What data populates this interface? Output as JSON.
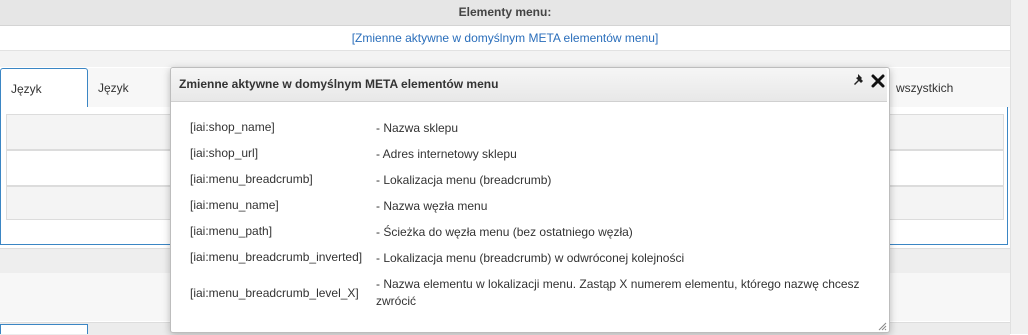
{
  "page": {
    "section_title": "Elementy menu:",
    "meta_link": "[Zmienne aktywne w domyślnym META elementów menu]"
  },
  "tabs": [
    {
      "label": "Język Polski",
      "active": true
    },
    {
      "label": "Język English",
      "active": false
    },
    {
      "label": "wszystkich językach",
      "active": false
    }
  ],
  "dialog": {
    "title": "Zmienne aktywne w domyślnym META elementów menu",
    "icons": {
      "pin": "pin-icon",
      "close": "close-icon"
    },
    "variables": [
      {
        "key": "[iai:shop_name]",
        "desc": "- Nazwa sklepu"
      },
      {
        "key": "[iai:shop_url]",
        "desc": "- Adres internetowy sklepu"
      },
      {
        "key": "[iai:menu_breadcrumb]",
        "desc": "- Lokalizacja menu (breadcrumb)"
      },
      {
        "key": "[iai:menu_name]",
        "desc": "- Nazwa węzła menu"
      },
      {
        "key": "[iai:menu_path]",
        "desc": "- Ścieżka do węzła menu (bez ostatniego węzła)"
      },
      {
        "key": "[iai:menu_breadcrumb_inverted]",
        "desc": "- Lokalizacja menu (breadcrumb) w odwróconej kolejności"
      },
      {
        "key": "[iai:menu_breadcrumb_level_X]",
        "desc": "- Nazwa elementu w lokalizacji menu. Zastąp X numerem elementu, którego nazwę chcesz zwrócić"
      }
    ]
  },
  "colors": {
    "link": "#2a6ebb",
    "active_tab_border": "#3b86c4"
  }
}
